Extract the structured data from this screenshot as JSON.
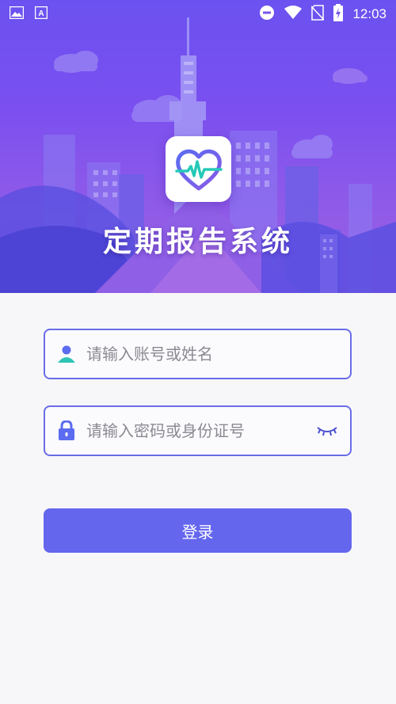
{
  "status_bar": {
    "time": "12:03",
    "icons": [
      "image-icon",
      "font-icon",
      "do-not-disturb-icon",
      "wifi-icon",
      "no-sim-icon",
      "battery-charging-icon"
    ]
  },
  "app": {
    "title": "定期报告系统",
    "icon": "heart-pulse-icon"
  },
  "form": {
    "account_placeholder": "请输入账号或姓名",
    "account_value": "",
    "password_placeholder": "请输入密码或身份证号",
    "password_value": "",
    "login_label": "登录"
  },
  "colors": {
    "accent": "#6466ee",
    "field_border": "#6a6ce8",
    "hero_top": "#6b52f0",
    "hero_bottom": "#9c62e4"
  }
}
